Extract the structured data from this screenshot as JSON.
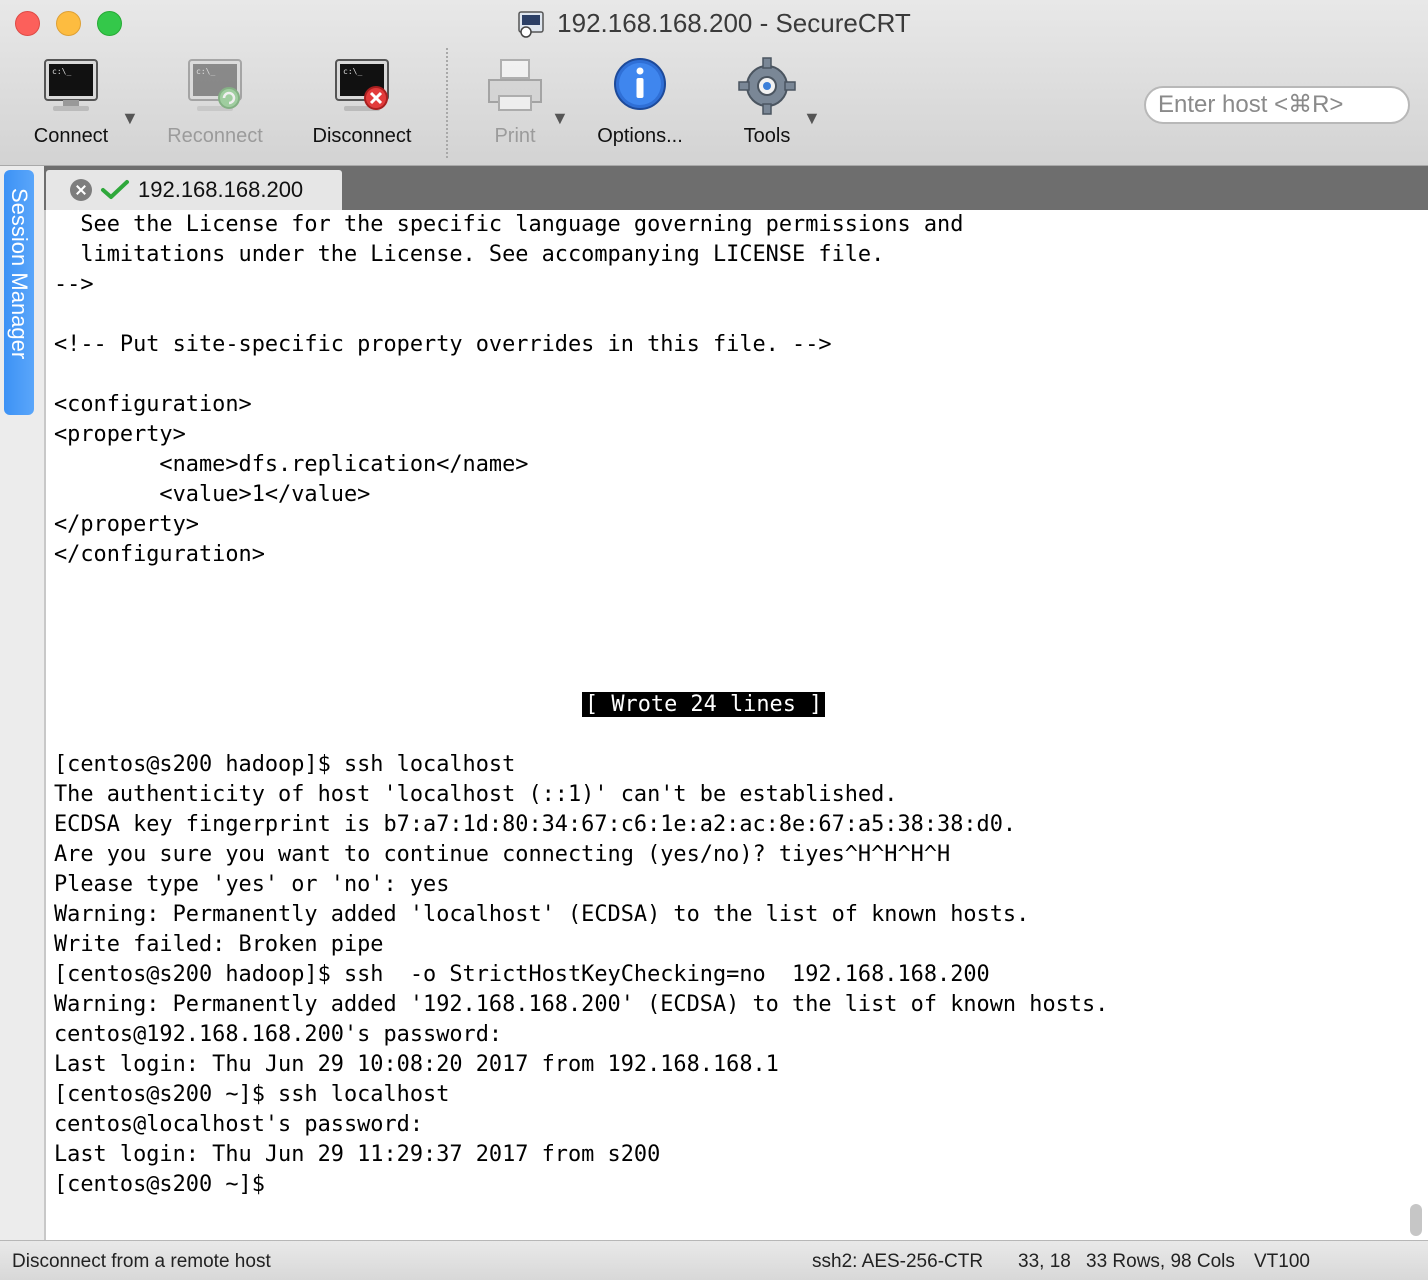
{
  "window": {
    "title": "192.168.168.200 - SecureCRT"
  },
  "toolbar": {
    "connect": "Connect",
    "reconnect": "Reconnect",
    "disconnect": "Disconnect",
    "print": "Print",
    "options": "Options...",
    "tools": "Tools",
    "host_placeholder": "Enter host <⌘R>"
  },
  "sidebar": {
    "session_manager": "Session Manager"
  },
  "tabs": [
    {
      "label": "192.168.168.200"
    }
  ],
  "terminal": {
    "lines": [
      "  See the License for the specific language governing permissions and",
      "  limitations under the License. See accompanying LICENSE file.",
      "-->",
      "",
      "<!-- Put site-specific property overrides in this file. -->",
      "",
      "<configuration>",
      "<property>",
      "        <name>dfs.replication</name>",
      "        <value>1</value>",
      "</property>",
      "</configuration>",
      "",
      "",
      "",
      "",
      "",
      "",
      "[centos@s200 hadoop]$ ssh localhost",
      "The authenticity of host 'localhost (::1)' can't be established.",
      "ECDSA key fingerprint is b7:a7:1d:80:34:67:c6:1e:a2:ac:8e:67:a5:38:38:d0.",
      "Are you sure you want to continue connecting (yes/no)? tiyes^H^H^H^H",
      "Please type 'yes' or 'no': yes",
      "Warning: Permanently added 'localhost' (ECDSA) to the list of known hosts.",
      "Write failed: Broken pipe",
      "[centos@s200 hadoop]$ ssh  -o StrictHostKeyChecking=no  192.168.168.200",
      "Warning: Permanently added '192.168.168.200' (ECDSA) to the list of known hosts.",
      "centos@192.168.168.200's password:",
      "Last login: Thu Jun 29 10:08:20 2017 from 192.168.168.1",
      "[centos@s200 ~]$ ssh localhost",
      "centos@localhost's password:",
      "Last login: Thu Jun 29 11:29:37 2017 from s200",
      "[centos@s200 ~]$"
    ],
    "highlight_line_index": 16,
    "highlight_text": "[ Wrote 24 lines ]"
  },
  "status": {
    "message": "Disconnect from a remote host",
    "cipher": "ssh2: AES-256-CTR",
    "cursor": "33, 18",
    "size": "33 Rows, 98 Cols",
    "emulation": "VT100"
  }
}
